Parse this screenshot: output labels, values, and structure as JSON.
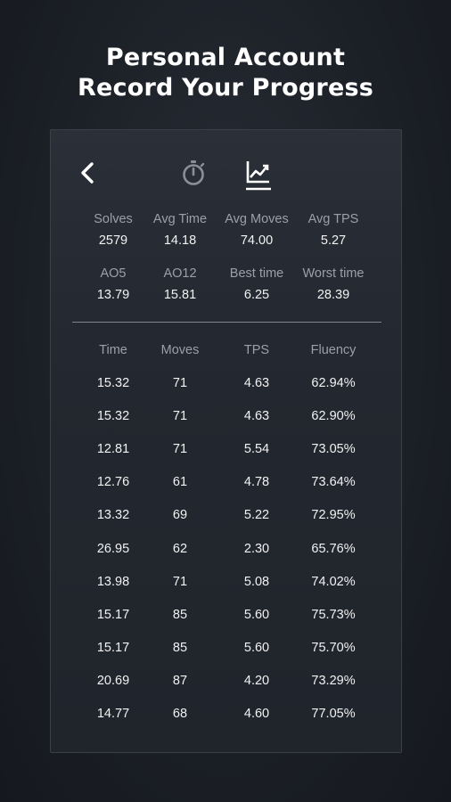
{
  "headline": {
    "line1": "Personal Account",
    "line2": "Record Your Progress"
  },
  "toolbar": {
    "icons": [
      "back-chevron-icon",
      "stopwatch-icon",
      "line-chart-icon"
    ],
    "active_tab": "line-chart-icon"
  },
  "stats": {
    "row1": [
      {
        "label": "Solves",
        "value": "2579"
      },
      {
        "label": "Avg Time",
        "value": "14.18"
      },
      {
        "label": "Avg Moves",
        "value": "74.00"
      },
      {
        "label": "Avg TPS",
        "value": "5.27"
      }
    ],
    "row2": [
      {
        "label": "AO5",
        "value": "13.79"
      },
      {
        "label": "AO12",
        "value": "15.81"
      },
      {
        "label": "Best time",
        "value": "6.25"
      },
      {
        "label": "Worst time",
        "value": "28.39"
      }
    ]
  },
  "table": {
    "headers": [
      "Time",
      "Moves",
      "TPS",
      "Fluency"
    ],
    "rows": [
      [
        "15.32",
        "71",
        "4.63",
        "62.94%"
      ],
      [
        "15.32",
        "71",
        "4.63",
        "62.90%"
      ],
      [
        "12.81",
        "71",
        "5.54",
        "73.05%"
      ],
      [
        "12.76",
        "61",
        "4.78",
        "73.64%"
      ],
      [
        "13.32",
        "69",
        "5.22",
        "72.95%"
      ],
      [
        "26.95",
        "62",
        "2.30",
        "65.76%"
      ],
      [
        "13.98",
        "71",
        "5.08",
        "74.02%"
      ],
      [
        "15.17",
        "85",
        "5.60",
        "75.73%"
      ],
      [
        "15.17",
        "85",
        "5.60",
        "75.70%"
      ],
      [
        "20.69",
        "87",
        "4.20",
        "73.29%"
      ],
      [
        "14.77",
        "68",
        "4.60",
        "77.05%"
      ]
    ]
  },
  "colors": {
    "background": "#1c2027",
    "card": "#252930",
    "label": "#9aa0aa",
    "value": "#f2f2f2",
    "divider": "#7e8592"
  }
}
